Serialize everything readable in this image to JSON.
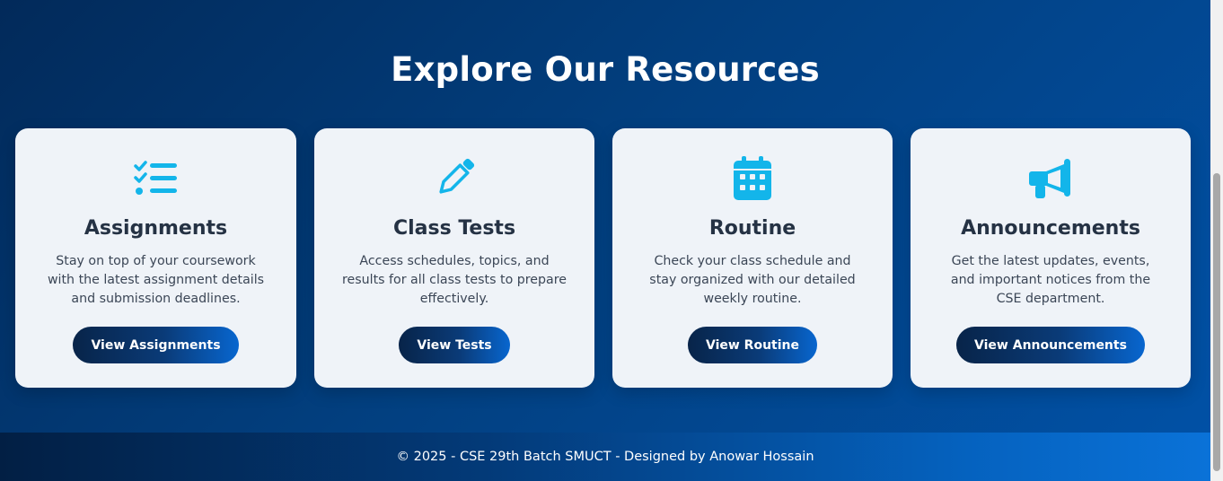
{
  "section": {
    "title": "Explore Our Resources"
  },
  "cards": [
    {
      "icon": "list-check-icon",
      "title": "Assignments",
      "description": "Stay on top of your coursework with the latest assignment details and submission deadlines.",
      "button": "View Assignments"
    },
    {
      "icon": "pencil-icon",
      "title": "Class Tests",
      "description": "Access schedules, topics, and results for all class tests to prepare effectively.",
      "button": "View Tests"
    },
    {
      "icon": "calendar-icon",
      "title": "Routine",
      "description": "Check your class schedule and stay organized with our detailed weekly routine.",
      "button": "View Routine"
    },
    {
      "icon": "megaphone-icon",
      "title": "Announcements",
      "description": "Get the latest updates, events, and important notices from the CSE department.",
      "button": "View Announcements"
    }
  ],
  "footer": {
    "text": "© 2025 - CSE 29th Batch SMUCT - Designed by Anowar Hossain"
  },
  "colors": {
    "accent_icon": "#13b5ea",
    "card_bg": "#eff3f8",
    "page_bg": "#023f7f"
  }
}
